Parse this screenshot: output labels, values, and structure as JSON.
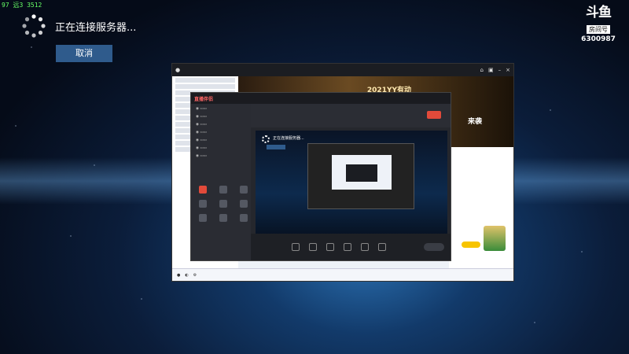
{
  "corner": {
    "text": "97 远3 3512"
  },
  "connection": {
    "status": "正在连接服务器...",
    "cancel": "取消"
  },
  "room": {
    "logo": "斗鱼",
    "tag": "房间号",
    "number": "6300987"
  },
  "app1": {
    "banner_title": "2021YY有动",
    "banner_sub": "来袭"
  },
  "app2": {
    "logo": "直播伴侣",
    "nested_status": "正在连接服务器..."
  }
}
